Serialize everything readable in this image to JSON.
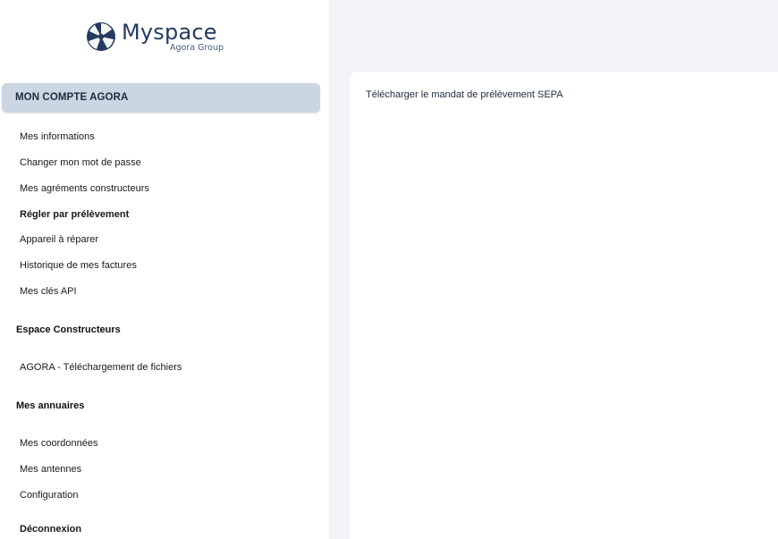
{
  "brand": {
    "name": "Myspace",
    "subtitle": "Agora Group",
    "logo_icon": "aperture-icon",
    "color": "#253b5e"
  },
  "sidebar": {
    "active_section": "MON COMPTE AGORA",
    "account_items": [
      {
        "label": "Mes informations",
        "bold": false
      },
      {
        "label": "Changer mon mot de passe",
        "bold": false
      },
      {
        "label": "Mes agréments constructeurs",
        "bold": false
      },
      {
        "label": "Régler par prélèvement",
        "bold": true
      },
      {
        "label": "Appareil à réparer",
        "bold": false
      },
      {
        "label": "Historique de mes factures",
        "bold": false
      },
      {
        "label": "Mes clés API",
        "bold": false
      }
    ],
    "builders_section": "Espace Constructeurs",
    "builders_items": [
      {
        "label": "AGORA - Téléchargement de fichiers"
      }
    ],
    "directories_section": "Mes annuaires",
    "directories_items": [
      {
        "label": "Mes coordonnées"
      },
      {
        "label": "Mes antennes"
      },
      {
        "label": "Configuration"
      }
    ],
    "logout": "Déconnexion"
  },
  "main": {
    "sepa_link": "Télécharger le mandat de prélèvement SEPA"
  },
  "colors": {
    "active_bg": "#cbd6e3",
    "page_bg": "#f1f3f6"
  }
}
